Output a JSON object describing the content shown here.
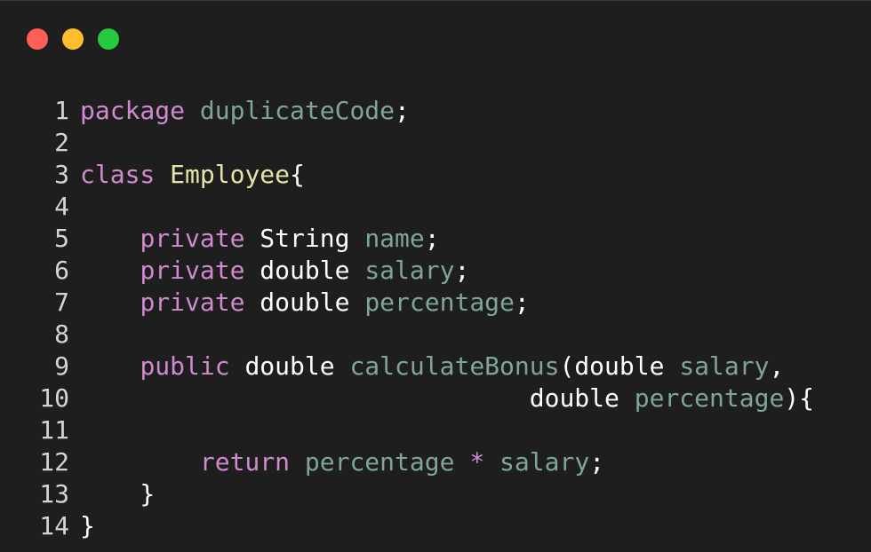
{
  "window": {
    "buttons": [
      {
        "name": "close",
        "color": "#ff5f56"
      },
      {
        "name": "minimize",
        "color": "#ffbd2e"
      },
      {
        "name": "maximize",
        "color": "#27c93f"
      }
    ]
  },
  "colors": {
    "keyword": "#cf8ad0",
    "identifier": "#7fa59a",
    "class_name": "#e6e3a5",
    "plain": "#ffffff",
    "line_number": "#d4d4d4",
    "background": "#1e1e1e"
  },
  "code": {
    "lines": [
      {
        "number": "1",
        "tokens": [
          {
            "t": "kw",
            "v": "package"
          },
          {
            "t": "pl",
            "v": " "
          },
          {
            "t": "id",
            "v": "duplicateCode"
          },
          {
            "t": "pl",
            "v": ";"
          }
        ]
      },
      {
        "number": "2",
        "tokens": []
      },
      {
        "number": "3",
        "tokens": [
          {
            "t": "kw",
            "v": "class"
          },
          {
            "t": "pl",
            "v": " "
          },
          {
            "t": "cls",
            "v": "Employee"
          },
          {
            "t": "pl",
            "v": "{"
          }
        ]
      },
      {
        "number": "4",
        "tokens": []
      },
      {
        "number": "5",
        "tokens": [
          {
            "t": "pl",
            "v": "    "
          },
          {
            "t": "kw",
            "v": "private"
          },
          {
            "t": "pl",
            "v": " String "
          },
          {
            "t": "id",
            "v": "name"
          },
          {
            "t": "pl",
            "v": ";"
          }
        ]
      },
      {
        "number": "6",
        "tokens": [
          {
            "t": "pl",
            "v": "    "
          },
          {
            "t": "kw",
            "v": "private"
          },
          {
            "t": "pl",
            "v": " double "
          },
          {
            "t": "id",
            "v": "salary"
          },
          {
            "t": "pl",
            "v": ";"
          }
        ]
      },
      {
        "number": "7",
        "tokens": [
          {
            "t": "pl",
            "v": "    "
          },
          {
            "t": "kw",
            "v": "private"
          },
          {
            "t": "pl",
            "v": " double "
          },
          {
            "t": "id",
            "v": "percentage"
          },
          {
            "t": "pl",
            "v": ";"
          }
        ]
      },
      {
        "number": "8",
        "tokens": []
      },
      {
        "number": "9",
        "tokens": [
          {
            "t": "pl",
            "v": "    "
          },
          {
            "t": "kw",
            "v": "public"
          },
          {
            "t": "pl",
            "v": " double "
          },
          {
            "t": "id",
            "v": "calculateBonus"
          },
          {
            "t": "pl",
            "v": "(double "
          },
          {
            "t": "id",
            "v": "salary"
          },
          {
            "t": "pl",
            "v": ","
          }
        ]
      },
      {
        "number": "10",
        "tokens": [
          {
            "t": "pl",
            "v": "                              double "
          },
          {
            "t": "id",
            "v": "percentage"
          },
          {
            "t": "pl",
            "v": "){"
          }
        ]
      },
      {
        "number": "11",
        "tokens": []
      },
      {
        "number": "12",
        "tokens": [
          {
            "t": "pl",
            "v": "        "
          },
          {
            "t": "kw",
            "v": "return"
          },
          {
            "t": "pl",
            "v": " "
          },
          {
            "t": "id",
            "v": "percentage"
          },
          {
            "t": "pl",
            "v": " "
          },
          {
            "t": "kw",
            "v": "*"
          },
          {
            "t": "pl",
            "v": " "
          },
          {
            "t": "id",
            "v": "salary"
          },
          {
            "t": "pl",
            "v": ";"
          }
        ]
      },
      {
        "number": "13",
        "tokens": [
          {
            "t": "pl",
            "v": "    }"
          }
        ]
      },
      {
        "number": "14",
        "tokens": [
          {
            "t": "pl",
            "v": "}"
          }
        ]
      }
    ]
  }
}
